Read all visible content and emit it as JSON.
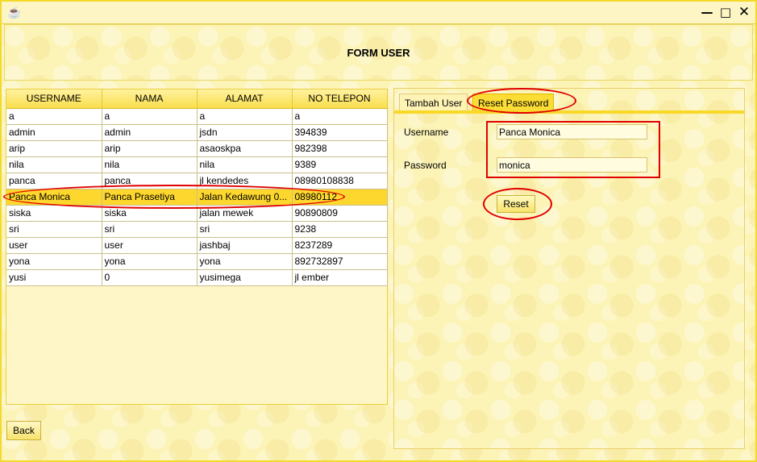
{
  "window": {
    "app_icon": "java-coffee-icon",
    "minimize_glyph": "—",
    "maximize_glyph": "□",
    "close_glyph": "✕"
  },
  "header": {
    "title": "FORM USER"
  },
  "table": {
    "columns": [
      "USERNAME",
      "NAMA",
      "ALAMAT",
      "NO TELEPON"
    ],
    "selected_index": 5,
    "rows": [
      [
        "a",
        "a",
        "a",
        "a"
      ],
      [
        "admin",
        "admin",
        "jsdn",
        "394839"
      ],
      [
        "arip",
        "arip",
        "asaoskpa",
        "982398"
      ],
      [
        "nila",
        "nila",
        "nila",
        "9389"
      ],
      [
        "panca",
        "panca",
        "jl kendedes",
        "08980108838"
      ],
      [
        "Panca Monica",
        "Panca Prasetiya",
        "Jalan Kedawung 0...",
        "08980112"
      ],
      [
        "siska",
        "siska",
        "jalan mewek",
        "90890809"
      ],
      [
        "sri",
        "sri",
        "sri",
        "9238"
      ],
      [
        "user",
        "user",
        "jashbaj",
        "8237289"
      ],
      [
        "yona",
        "yona",
        "yona",
        "892732897"
      ],
      [
        "yusi",
        "0",
        "yusimega",
        "jl ember"
      ]
    ]
  },
  "back_button": {
    "label": "Back"
  },
  "tabs": [
    {
      "label": "Tambah User",
      "active": false
    },
    {
      "label": "Reset Password",
      "active": true
    }
  ],
  "form": {
    "username_label": "Username",
    "username_value": "Panca Monica",
    "password_label": "Password",
    "password_value": "monica",
    "reset_label": "Reset"
  },
  "colors": {
    "accent": "#fbdc34",
    "selection": "#fed72e",
    "annotation": "#e00000"
  }
}
